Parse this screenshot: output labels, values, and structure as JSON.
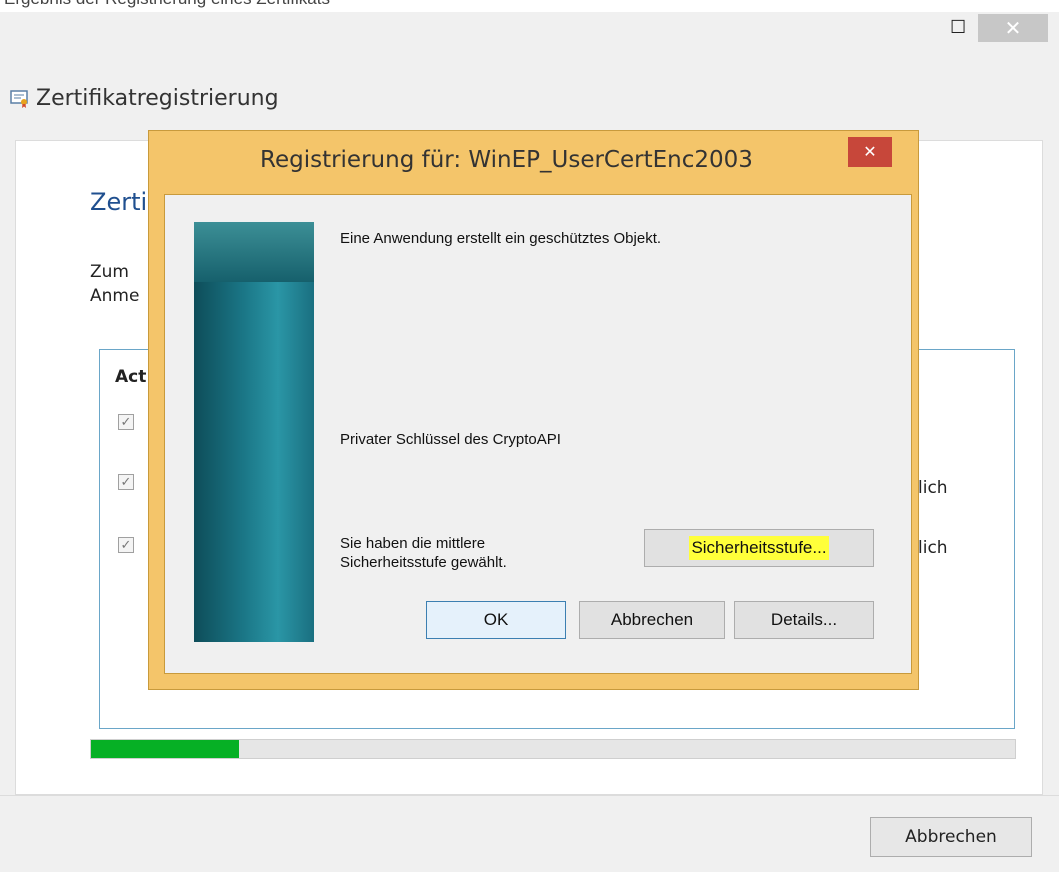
{
  "window": {
    "cutoff_text": "Ergebnis der Registrierung eines Zertifikats",
    "title": "Zertifikatregistrierung",
    "minimize_glyph": "—",
    "maximize_glyph": "☐",
    "close_glyph": "✕"
  },
  "page": {
    "heading": "Zerti",
    "description_line1": "Zum",
    "description_line2": "Anme",
    "actions_header": "Act",
    "status_row1": "lich",
    "status_row2": "lich",
    "progress_fraction": 0.16,
    "cancel_label": "Abbrechen"
  },
  "dialog": {
    "title": "Registrierung für: WinEP_UserCertEnc2003",
    "close_glyph": "✕",
    "message": "Eine Anwendung erstellt ein geschütztes Objekt.",
    "object_name": "Privater Schlüssel des CryptoAPI",
    "security_line1": "Sie haben die mittlere",
    "security_line2": "Sicherheitsstufe gewählt.",
    "security_button": "Sicherheitsstufe...",
    "ok_button": "OK",
    "cancel_button": "Abbrechen",
    "details_button": "Details..."
  },
  "colors": {
    "dialog_frame": "#f4c56a",
    "progress": "#06b025",
    "highlight": "#ffff3a",
    "heading": "#1f4f8f"
  },
  "icons": {
    "app": "certificate-icon",
    "check": "checkmark-icon"
  }
}
